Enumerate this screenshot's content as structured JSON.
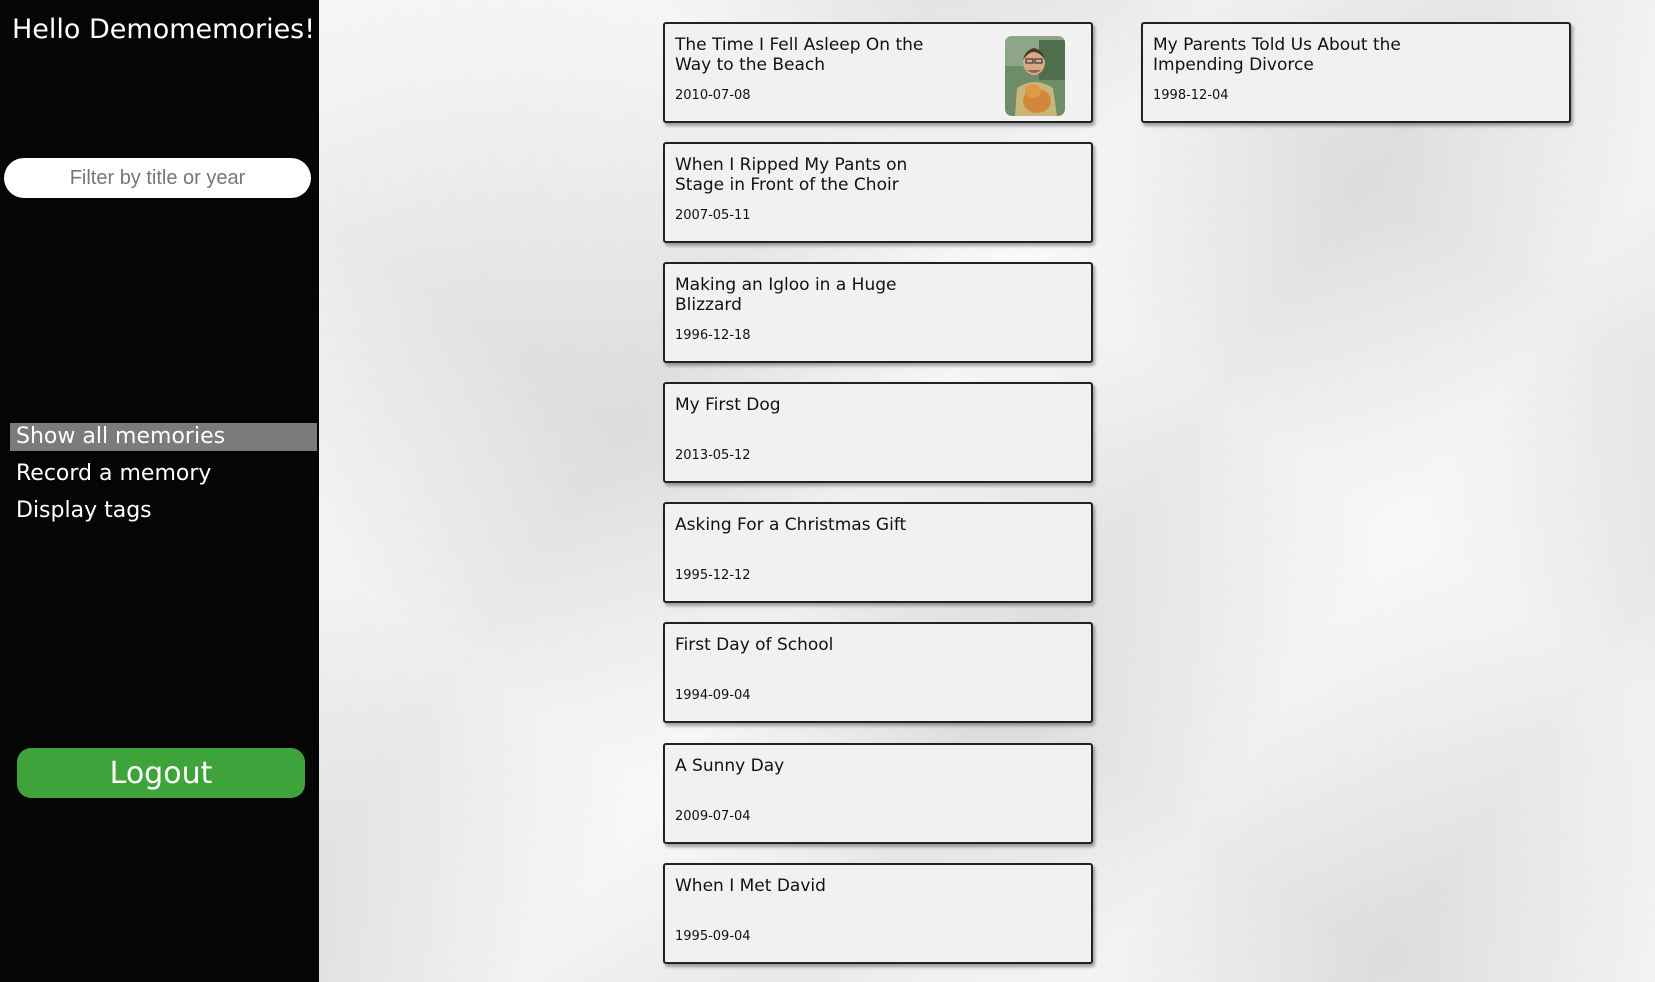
{
  "greeting": "Hello Demomemories!",
  "search": {
    "placeholder": "Filter by title or year"
  },
  "nav": {
    "show_all": "Show all memories",
    "record": "Record a memory",
    "tags": "Display tags"
  },
  "logout_label": "Logout",
  "memories": [
    {
      "title": "The Time I Fell Asleep On the Way to the Beach",
      "date": "2010-07-08",
      "has_thumbnail": true
    },
    {
      "title": "When I Ripped My Pants on Stage in Front of the Choir",
      "date": "2007-05-11"
    },
    {
      "title": "Making an Igloo in a Huge Blizzard",
      "date": "1996-12-18"
    },
    {
      "title": "My First Dog",
      "date": "2013-05-12"
    },
    {
      "title": "Asking For a Christmas Gift",
      "date": "1995-12-12"
    },
    {
      "title": "First Day of School",
      "date": "1994-09-04"
    },
    {
      "title": "A Sunny Day",
      "date": "2009-07-04"
    },
    {
      "title": "When I Met David",
      "date": "1995-09-04"
    },
    {
      "title": "My Parents Told Us About the Impending Divorce",
      "date": "1998-12-04"
    }
  ],
  "colors": {
    "sidebar": "#050505",
    "active_nav": "#7b7b7b",
    "logout": "#3fa33b"
  }
}
